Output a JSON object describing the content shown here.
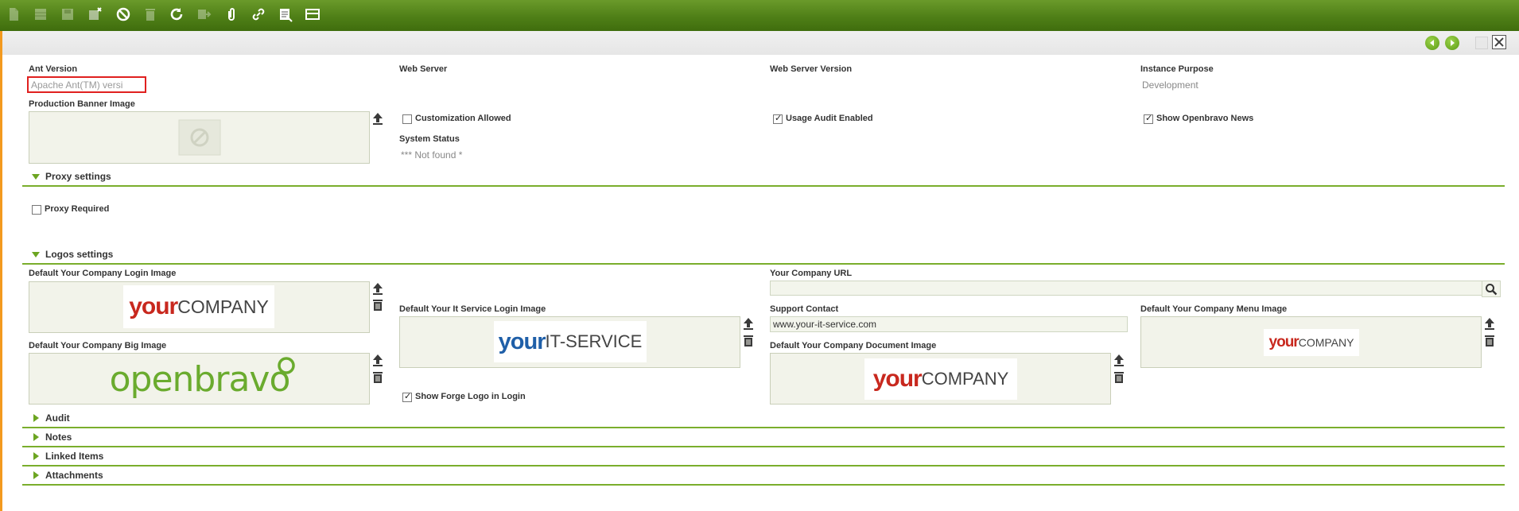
{
  "toolbar": {
    "buttons": [
      {
        "icon": "new-document-icon",
        "enabled": false
      },
      {
        "icon": "grid-view-icon",
        "enabled": false
      },
      {
        "icon": "save-icon",
        "enabled": false
      },
      {
        "icon": "save-close-icon",
        "enabled": true
      },
      {
        "icon": "undo-icon",
        "enabled": true
      },
      {
        "icon": "delete-icon",
        "enabled": false
      },
      {
        "icon": "refresh-icon",
        "enabled": true
      },
      {
        "icon": "export-icon",
        "enabled": false
      },
      {
        "icon": "attachment-icon",
        "enabled": true
      },
      {
        "icon": "link-icon",
        "enabled": true
      },
      {
        "icon": "audit-trail-icon",
        "enabled": true
      },
      {
        "icon": "tree-view-icon",
        "enabled": true
      }
    ]
  },
  "nav": {
    "prev_icon": "previous-record-icon",
    "next_icon": "next-record-icon",
    "maximize_icon": "maximize-icon",
    "close_icon": "close-icon"
  },
  "form": {
    "ant_version": {
      "label": "Ant Version",
      "value": "Apache Ant(TM) versi"
    },
    "web_server": {
      "label": "Web Server"
    },
    "web_server_version": {
      "label": "Web Server Version"
    },
    "instance_purpose": {
      "label": "Instance Purpose",
      "value": "Development"
    },
    "production_banner": {
      "label": "Production Banner Image"
    },
    "customization_allowed": {
      "label": "Customization Allowed",
      "checked": false
    },
    "usage_audit_enabled": {
      "label": "Usage Audit Enabled",
      "checked": true
    },
    "show_openbravo_news": {
      "label": "Show Openbravo News",
      "checked": true
    },
    "system_status": {
      "label": "System Status",
      "value": "*** Not found *"
    }
  },
  "sections": {
    "proxy": {
      "title": "Proxy settings",
      "expanded": true
    },
    "logos": {
      "title": "Logos settings",
      "expanded": true
    },
    "audit": {
      "title": "Audit"
    },
    "notes": {
      "title": "Notes"
    },
    "linked": {
      "title": "Linked Items"
    },
    "attachments": {
      "title": "Attachments"
    }
  },
  "proxy": {
    "proxy_required": {
      "label": "Proxy Required",
      "checked": false
    }
  },
  "logos": {
    "company_login": {
      "label": "Default Your Company Login Image",
      "logo_your": "your",
      "logo_rest": "COMPANY"
    },
    "company_url": {
      "label": "Your Company URL",
      "value": ""
    },
    "it_service_login": {
      "label": "Default Your It Service Login Image",
      "logo_your": "your",
      "logo_rest": "IT-SERVICE"
    },
    "support_contact": {
      "label": "Support Contact",
      "value": "www.your-it-service.com"
    },
    "company_menu": {
      "label": "Default Your Company Menu Image",
      "logo_your": "your",
      "logo_rest": "COMPANY"
    },
    "company_big": {
      "label": "Default Your Company Big Image",
      "logo_text": "openbravo"
    },
    "company_document": {
      "label": "Default Your Company Document Image",
      "logo_your": "your",
      "logo_rest": "COMPANY"
    },
    "show_forge_logo": {
      "label": "Show Forge Logo in Login",
      "checked": true
    }
  },
  "colors": {
    "toolbar": "#4f7f17",
    "accent": "#7aae2c",
    "left_bar": "#f39a1f",
    "focus_border": "#e0201f"
  }
}
